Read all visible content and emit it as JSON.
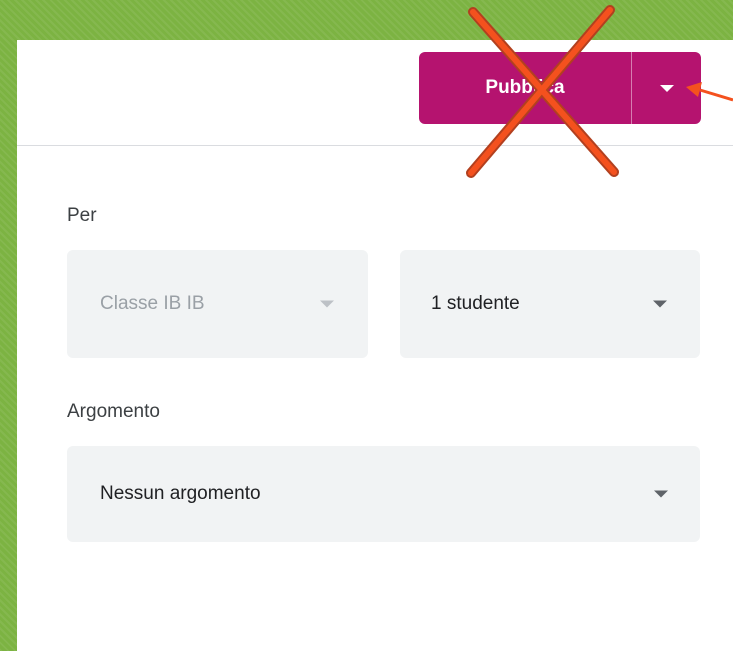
{
  "header": {
    "publish_label": "Pubblica",
    "publish_color": "#b5136f"
  },
  "form": {
    "for_label": "Per",
    "class_select": {
      "value": "Classe IB IB",
      "disabled": true
    },
    "students_select": {
      "value": "1 studente"
    },
    "topic_label": "Argomento",
    "topic_select": {
      "value": "Nessun argomento"
    }
  },
  "annotations": {
    "cross_color": "#f4511e",
    "arrow_color": "#f4511e",
    "background_color": "#7cb342"
  },
  "icons": {
    "dropdown": "chevron-down-icon",
    "cross": "cross-mark-icon",
    "arrow": "arrow-left-icon"
  }
}
